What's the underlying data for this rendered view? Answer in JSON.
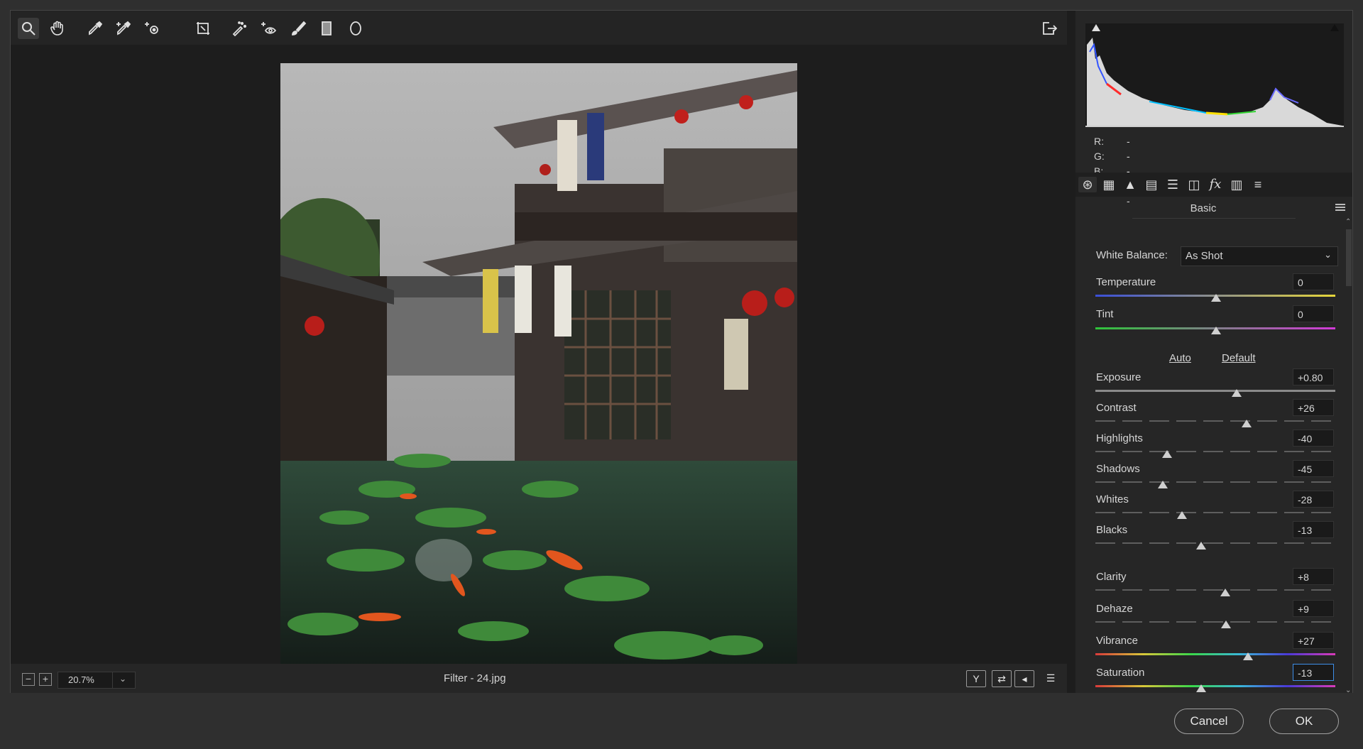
{
  "toolbar": {
    "tools": [
      "zoom-tool",
      "hand-tool",
      "white-balance-tool",
      "color-sampler-tool",
      "targeted-adjustment-tool",
      "transform-tool",
      "spot-removal-tool",
      "red-eye-removal-tool",
      "adjustment-brush-tool",
      "graduated-filter-tool",
      "radial-filter-tool"
    ]
  },
  "statusbar": {
    "zoom": "20.7%",
    "filename": "Filter  -  24.jpg"
  },
  "histogram": {
    "r_label": "R:",
    "r_value": "---",
    "g_label": "G:",
    "g_value": "---",
    "b_label": "B:",
    "b_value": "---"
  },
  "panel": {
    "title": "Basic",
    "white_balance_label": "White Balance:",
    "white_balance_value": "As Shot",
    "temperature_label": "Temperature",
    "temperature_value": "0",
    "tint_label": "Tint",
    "tint_value": "0",
    "auto_label": "Auto",
    "default_label": "Default",
    "sliders": [
      {
        "label": "Exposure",
        "value": "+0.80",
        "pos": 0.59
      },
      {
        "label": "Contrast",
        "value": "+26",
        "pos": 0.63
      },
      {
        "label": "Highlights",
        "value": "-40",
        "pos": 0.3
      },
      {
        "label": "Shadows",
        "value": "-45",
        "pos": 0.28
      },
      {
        "label": "Whites",
        "value": "-28",
        "pos": 0.36
      },
      {
        "label": "Blacks",
        "value": "-13",
        "pos": 0.44
      }
    ],
    "presence": [
      {
        "label": "Clarity",
        "value": "+8",
        "pos": 0.54
      },
      {
        "label": "Dehaze",
        "value": "+9",
        "pos": 0.545
      },
      {
        "label": "Vibrance",
        "value": "+27",
        "pos": 0.635
      },
      {
        "label": "Saturation",
        "value": "-13",
        "pos": 0.44
      }
    ]
  },
  "footer": {
    "cancel_label": "Cancel",
    "ok_label": "OK"
  },
  "colors": {
    "focus": "#3d8ee8",
    "background": "#1d1d1d"
  }
}
